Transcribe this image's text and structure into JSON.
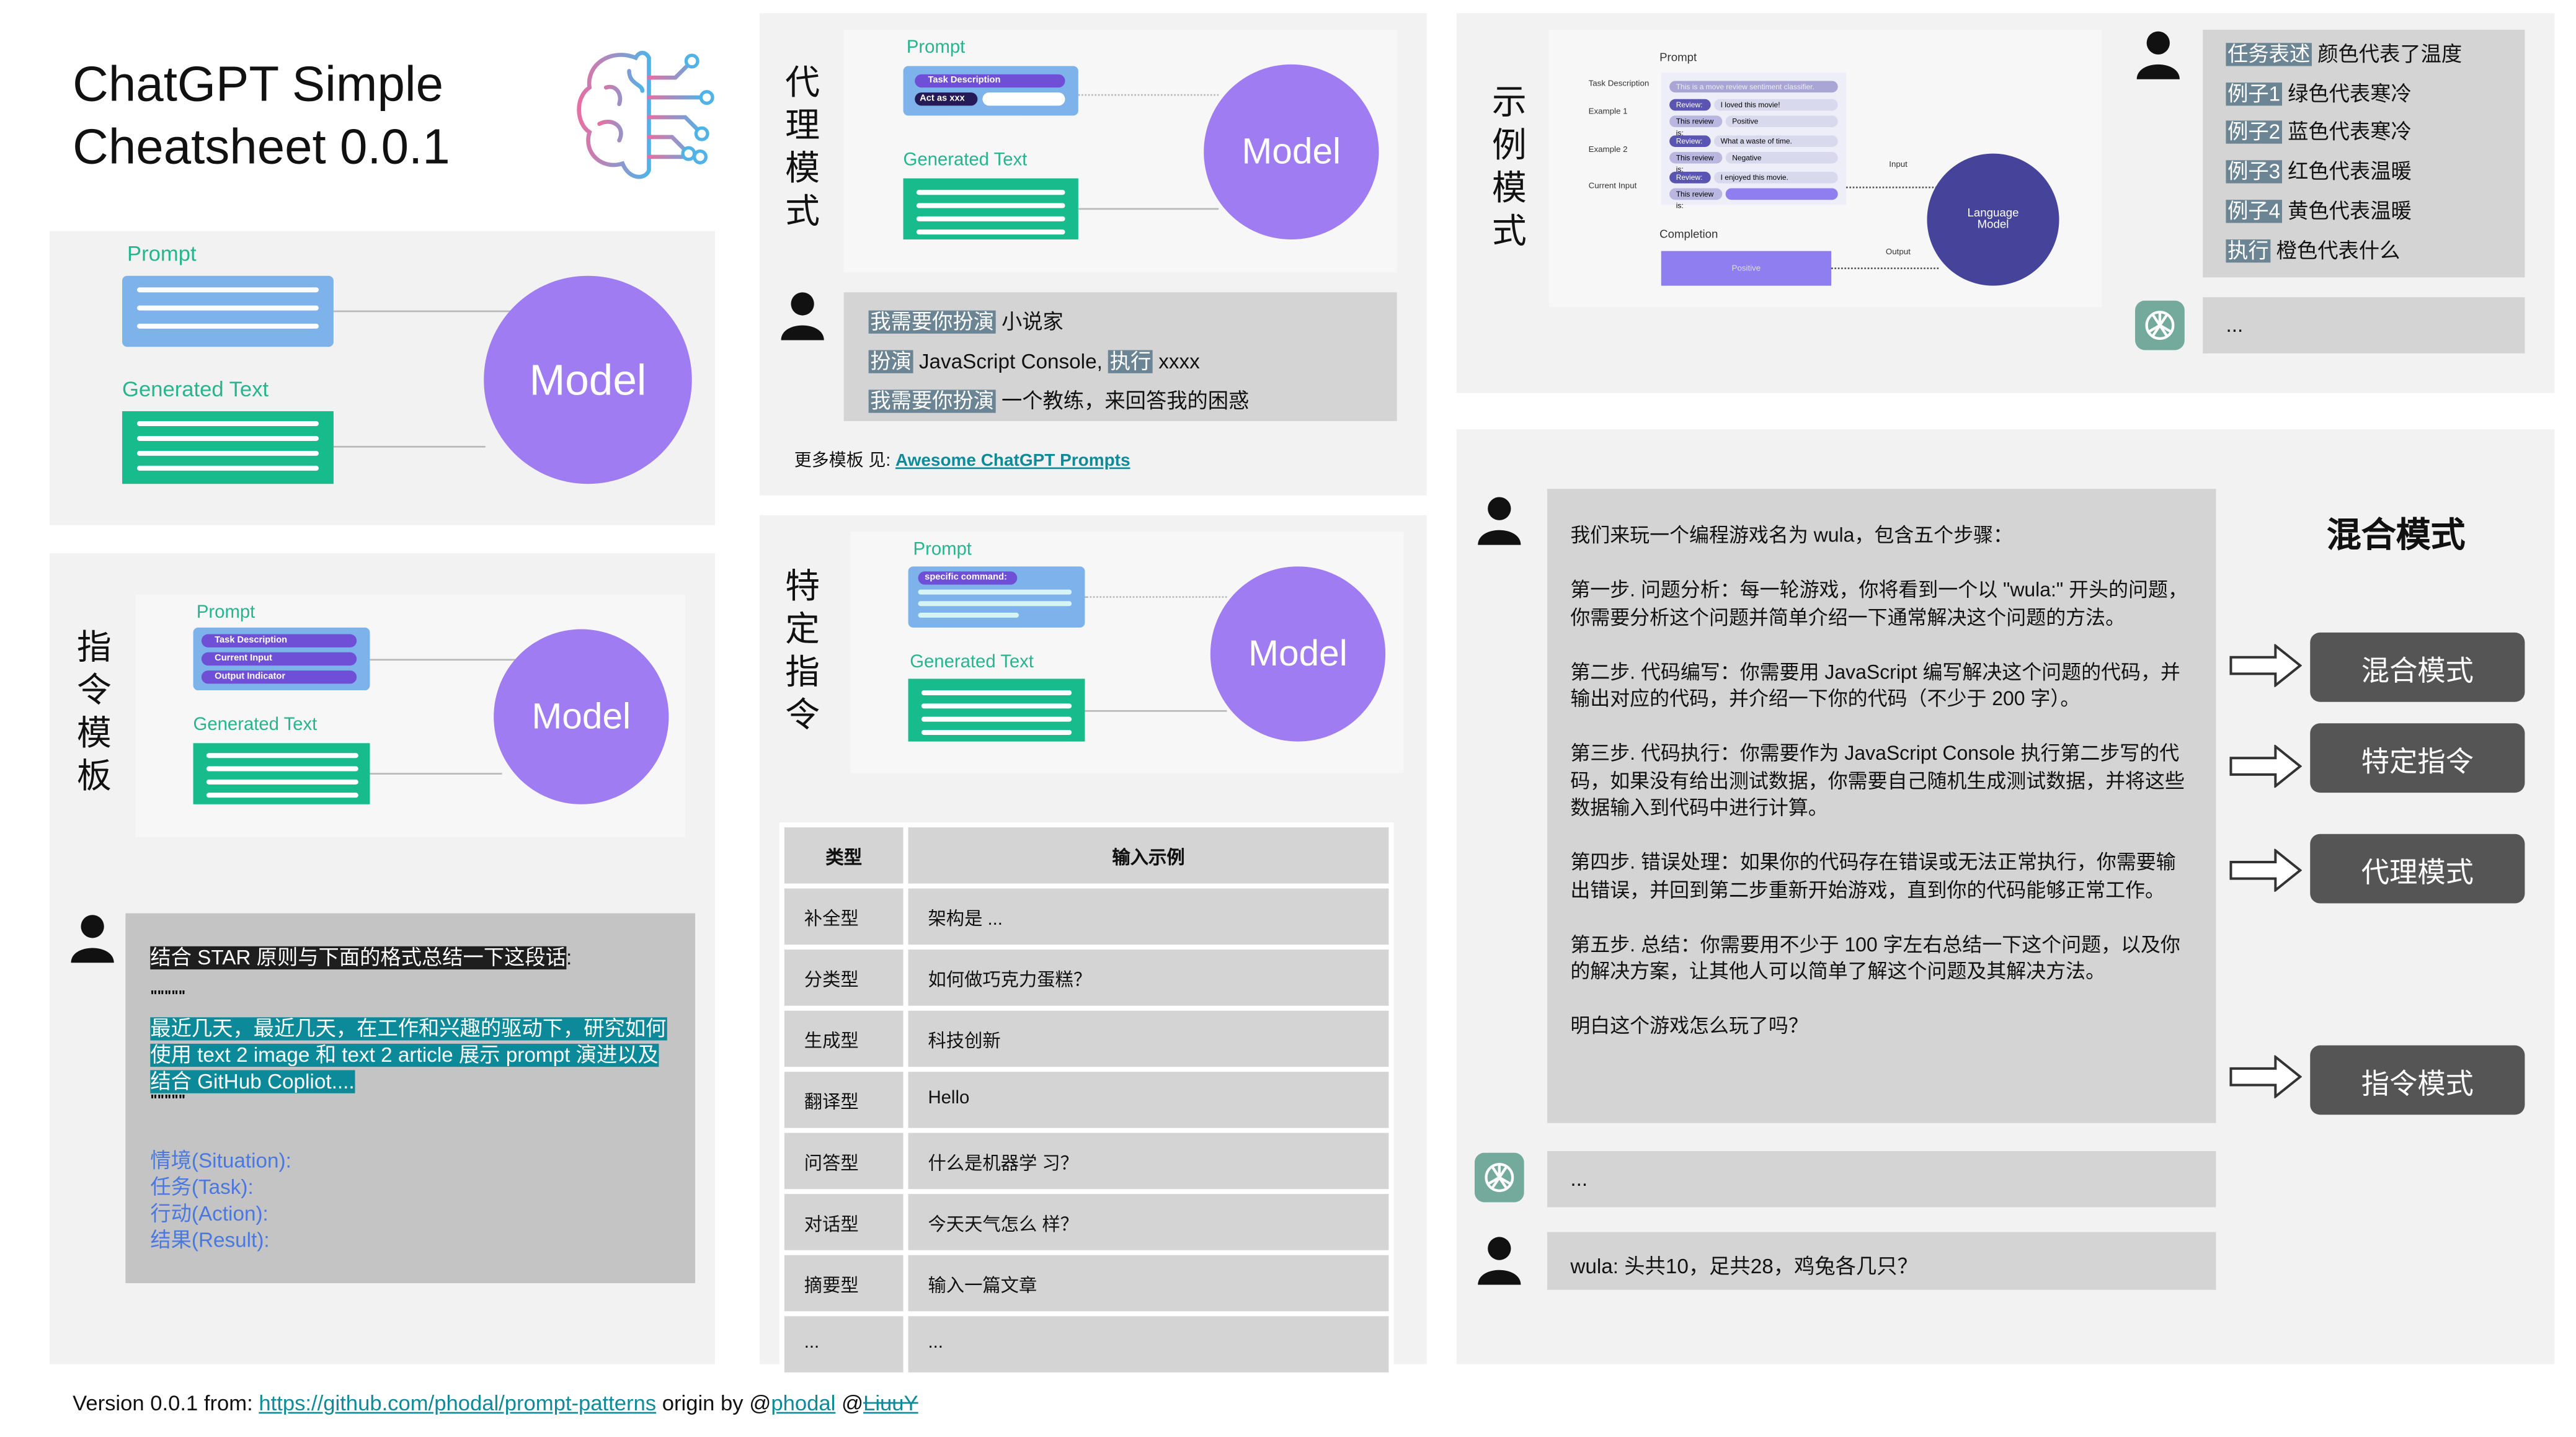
{
  "header": {
    "title_line1": "ChatGPT Simple",
    "title_line2": "Cheatsheet 0.0.1",
    "logo_icon": "brain-circuit-icon"
  },
  "colors": {
    "model": "#a07cf2",
    "prompt_box": "#7db3ea",
    "generated_box": "#18bb8c",
    "pill": "#6e4fd6",
    "language_model": "#45449a",
    "mode_button": "#555555",
    "link": "#0f8a99"
  },
  "basic": {
    "prompt_label": "Prompt",
    "generated_label": "Generated Text",
    "model_label": "Model"
  },
  "instruction_template": {
    "title": "指令模板",
    "diagram": {
      "prompt_label": "Prompt",
      "pills": [
        "Task Description",
        "Current Input",
        "Output Indicator"
      ],
      "generated_label": "Generated Text",
      "model_label": "Model"
    },
    "prompt": {
      "instruction": "结合 STAR 原则与下面的格式总结一下这段话",
      "colon": ":",
      "quote_open": "\"\"\"\"\"",
      "passage": "最近几天，最近几天，在工作和兴趣的驱动下，研究如何使用 text 2 image 和 text 2 article 展示 prompt 演进以及结合 GitHub Copliot....",
      "quote_close": "\"\"\"\"\"",
      "fields": [
        "情境(Situation):",
        "任务(Task):",
        "行动(Action):",
        "结果(Result):"
      ]
    }
  },
  "agent_mode": {
    "title": "代理模式",
    "diagram": {
      "prompt_label": "Prompt",
      "task_pill": "Task Description",
      "act_pill": "Act as xxx",
      "generated_label": "Generated Text",
      "model_label": "Model"
    },
    "lines": [
      {
        "hl": "我需要你扮演",
        "text": " 小说家"
      },
      {
        "hl": "扮演",
        "text": " JavaScript Console, ",
        "hl2": "执行",
        "text2": " xxxx"
      },
      {
        "hl": "我需要你扮演",
        "text": " 一个教练，来回答我的困惑"
      }
    ],
    "more_label": "更多模板 见: ",
    "more_link": "Awesome ChatGPT Prompts"
  },
  "specific_command": {
    "title": "特定指令",
    "diagram": {
      "prompt_label": "Prompt",
      "pill": "specific command:",
      "generated_label": "Generated Text",
      "model_label": "Model"
    },
    "table": {
      "headers": [
        "类型",
        "输入示例"
      ],
      "rows": [
        [
          "补全型",
          "架构是 ..."
        ],
        [
          "分类型",
          "如何做巧克力蛋糕？"
        ],
        [
          "生成型",
          "科技创新"
        ],
        [
          "翻译型",
          "Hello"
        ],
        [
          "问答型",
          "什么是机器学 习？"
        ],
        [
          "对话型",
          "今天天气怎么 样？"
        ],
        [
          "摘要型",
          "输入一篇文章"
        ],
        [
          "...",
          "..."
        ]
      ]
    }
  },
  "example_mode": {
    "title": "示例模式",
    "diagram": {
      "prompt_label": "Prompt",
      "completion_label": "Completion",
      "input_label": "Input",
      "output_label": "Output",
      "model_label": "Language Model",
      "task_label": "Task Description",
      "task_text": "This is a move review sentiment classifier.",
      "example1_label": "Example 1",
      "example2_label": "Example 2",
      "current_label": "Current Input",
      "review_tag": "Review:",
      "review_is_tag": "This review is:",
      "review1": "I loved this movie!",
      "answer1": "Positive",
      "review2": "What a waste of time.",
      "answer2": "Negative",
      "review3": "I enjoyed this movie.",
      "completion_value": "Positive"
    },
    "lines": [
      {
        "hl": "任务表述",
        "text": " 颜色代表了温度"
      },
      {
        "hl": "例子1",
        "text": " 绿色代表寒冷"
      },
      {
        "hl": "例子2",
        "text": " 蓝色代表寒冷"
      },
      {
        "hl": "例子3",
        "text": " 红色代表温暖"
      },
      {
        "hl": "例子4",
        "text": " 黄色代表温暖"
      },
      {
        "hl": "执行",
        "text": " 橙色代表什么"
      }
    ],
    "reply": "..."
  },
  "mixed_mode": {
    "title": "混合模式",
    "prompt_paragraphs": [
      "我们来玩一个编程游戏名为 wula，包含五个步骤：",
      "第一步. 问题分析：每一轮游戏，你将看到一个以 \"wula:\" 开头的问题，你需要分析这个问题并简单介绍一下通常解决这个问题的方法。",
      "第二步. 代码编写：你需要用 JavaScript 编写解决这个问题的代码，并输出对应的代码，并介绍一下你的代码（不少于 200 字）。",
      "第三步. 代码执行：你需要作为 JavaScript Console 执行第二步写的代码，如果没有给出测试数据，你需要自己随机生成测试数据，并将这些数据输入到代码中进行计算。",
      "第四步. 错误处理：如果你的代码存在错误或无法正常执行，你需要输出错误，并回到第二步重新开始游戏，直到你的代码能够正常工作。",
      "第五步. 总结：你需要用不少于 100 字左右总结一下这个问题，以及你的解决方案，让其他人可以简单了解这个问题及其解决方法。",
      "明白这个游戏怎么玩了吗？"
    ],
    "reply": "...",
    "followup": "wula: 头共10，足共28，鸡兔各几只？",
    "buttons": [
      "混合模式",
      "特定指令",
      "代理模式",
      "指令模式"
    ]
  },
  "footer": {
    "prefix": "Version 0.0.1 from: ",
    "repo_link": "https://github.com/phodal/prompt-patterns",
    "origin": " origin by @",
    "author1": "phodal",
    "sep": " @",
    "author2": "LiuuY"
  }
}
